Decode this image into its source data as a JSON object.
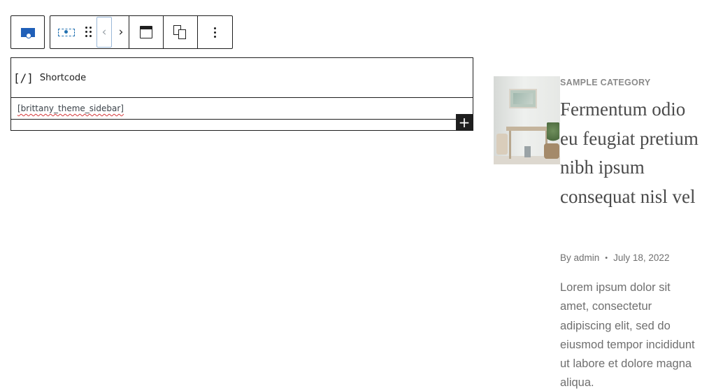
{
  "toolbar": {
    "parent_selector": {
      "icon": "cover-block-icon",
      "color": "#1f5fb8"
    },
    "block_type": {
      "icon": "shortcode-block-icon",
      "color": "#2271b1"
    },
    "drag": {
      "icon": "drag-handle-icon"
    },
    "move_left": {
      "glyph": "‹"
    },
    "move_right": {
      "glyph": "›"
    },
    "align": {
      "icon": "align-full-width-icon"
    },
    "transform": {
      "icon": "transform-icon"
    },
    "more": {
      "icon": "more-vertical-icon"
    }
  },
  "shortcode_block": {
    "bracket_icon": "[/]",
    "label": "Shortcode",
    "value": "[brittany_theme_sidebar]",
    "add_block_glyph": "+"
  },
  "post": {
    "category": "SAMPLE CATEGORY",
    "title": "Fermentum odio eu feugiat pretium nibh ipsum consequat nisl vel",
    "author": "By admin",
    "separator": "•",
    "date": "July 18, 2022",
    "excerpt": "Lorem ipsum dolor sit amet, consectetur adipiscing elit, sed do eiusmod tempor incididunt ut labore et dolore magna aliqua."
  }
}
